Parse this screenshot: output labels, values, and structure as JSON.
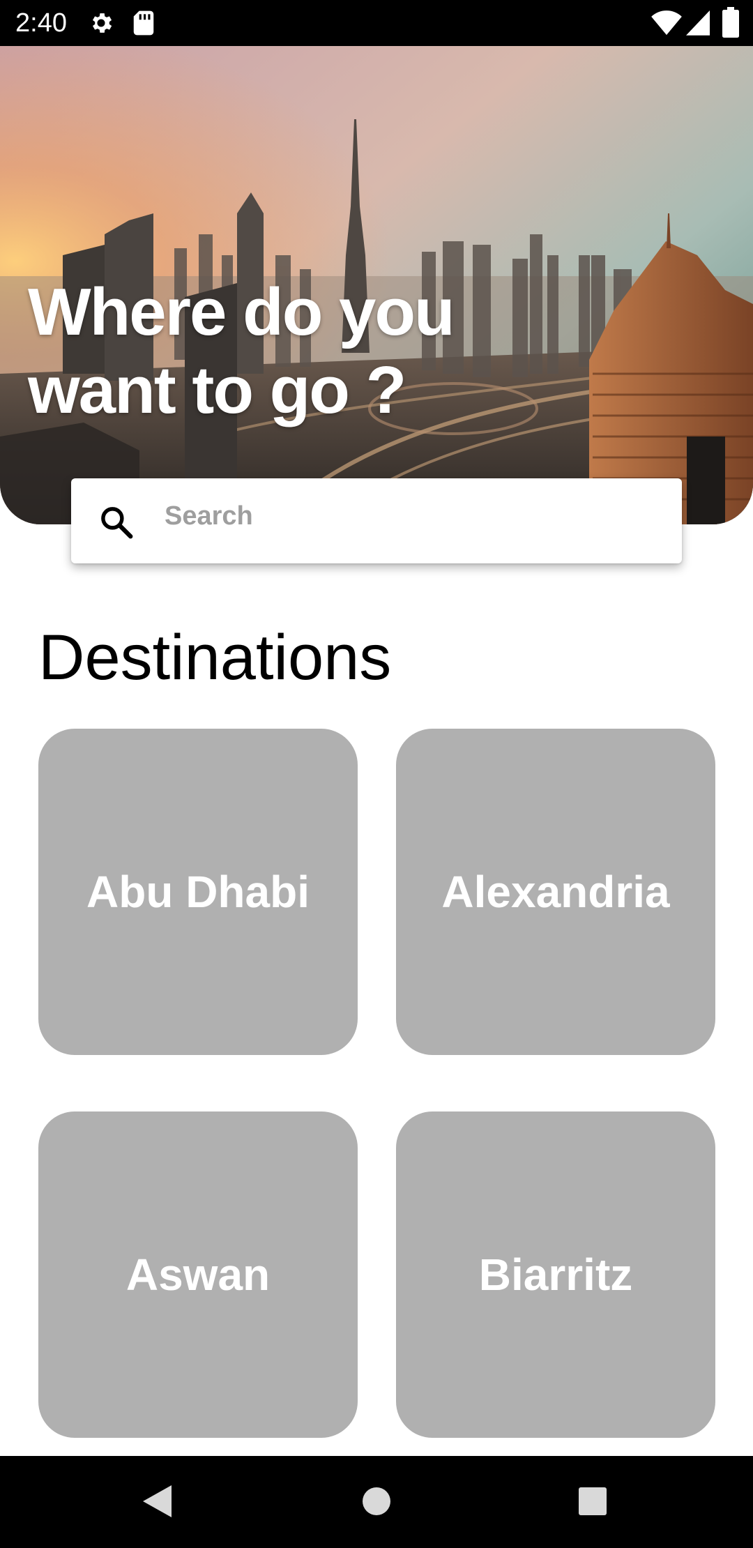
{
  "status_bar": {
    "time": "2:40",
    "icons": [
      "gear-icon",
      "sd-card-icon",
      "wifi-icon",
      "signal-icon",
      "battery-icon"
    ]
  },
  "hero": {
    "title_line1": "Where do you",
    "title_line2": "want to go ?"
  },
  "search": {
    "placeholder": "Search",
    "value": ""
  },
  "destinations": {
    "title": "Destinations",
    "items": [
      {
        "label": "Abu Dhabi"
      },
      {
        "label": "Alexandria"
      },
      {
        "label": "Aswan"
      },
      {
        "label": "Biarritz"
      }
    ]
  },
  "nav_bar": {
    "icons": [
      "back-icon",
      "home-icon",
      "recents-icon"
    ]
  },
  "colors": {
    "card_background": "#b0b0b0",
    "hero_text": "#ffffff",
    "placeholder": "#9e9e9e"
  }
}
